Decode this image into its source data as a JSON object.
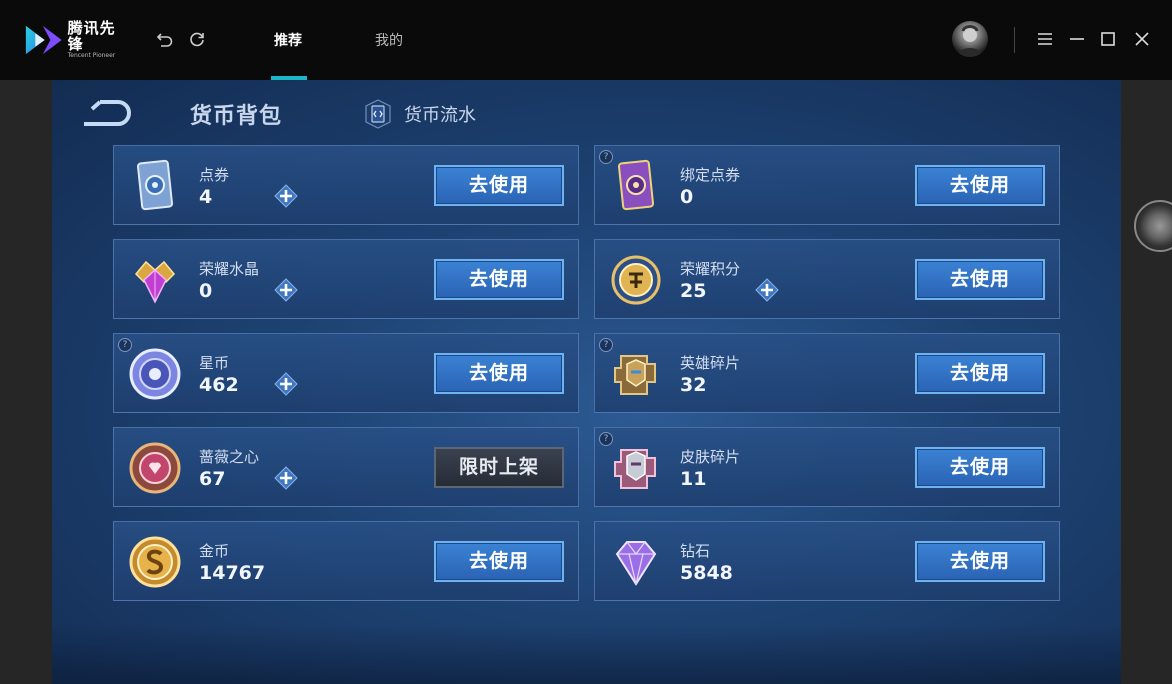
{
  "app": {
    "logo_cn": "腾讯先锋",
    "logo_en": "Tencent Pioneer",
    "tabs": [
      {
        "label": "推荐",
        "active": true
      },
      {
        "label": "我的",
        "active": false
      }
    ],
    "accent_color": "#1fb5c9"
  },
  "header": {
    "title": "货币背包",
    "flow_label": "货币流水"
  },
  "cards": [
    {
      "name": "点券",
      "value": "4",
      "button": "去使用",
      "has_plus": true,
      "has_help": false,
      "icon": "coupon-icon"
    },
    {
      "name": "绑定点券",
      "value": "0",
      "button": "去使用",
      "has_plus": false,
      "has_help": true,
      "icon": "bound-coupon-icon"
    },
    {
      "name": "荣耀水晶",
      "value": "0",
      "button": "去使用",
      "has_plus": true,
      "has_help": false,
      "icon": "glory-crystal-icon"
    },
    {
      "name": "荣耀积分",
      "value": "25",
      "button": "去使用",
      "has_plus": true,
      "has_help": false,
      "icon": "glory-points-icon"
    },
    {
      "name": "星币",
      "value": "462",
      "button": "去使用",
      "has_plus": true,
      "has_help": true,
      "icon": "star-coin-icon"
    },
    {
      "name": "英雄碎片",
      "value": "32",
      "button": "去使用",
      "has_plus": false,
      "has_help": true,
      "icon": "hero-fragment-icon"
    },
    {
      "name": "蔷薇之心",
      "value": "67",
      "button": "限时上架",
      "has_plus": true,
      "has_help": false,
      "icon": "rose-heart-icon"
    },
    {
      "name": "皮肤碎片",
      "value": "11",
      "button": "去使用",
      "has_plus": false,
      "has_help": true,
      "icon": "skin-fragment-icon"
    },
    {
      "name": "金币",
      "value": "14767",
      "button": "去使用",
      "has_plus": false,
      "has_help": false,
      "icon": "gold-coin-icon"
    },
    {
      "name": "钻石",
      "value": "5848",
      "button": "去使用",
      "has_plus": false,
      "has_help": false,
      "icon": "diamond-icon"
    }
  ],
  "help_mark": "?"
}
